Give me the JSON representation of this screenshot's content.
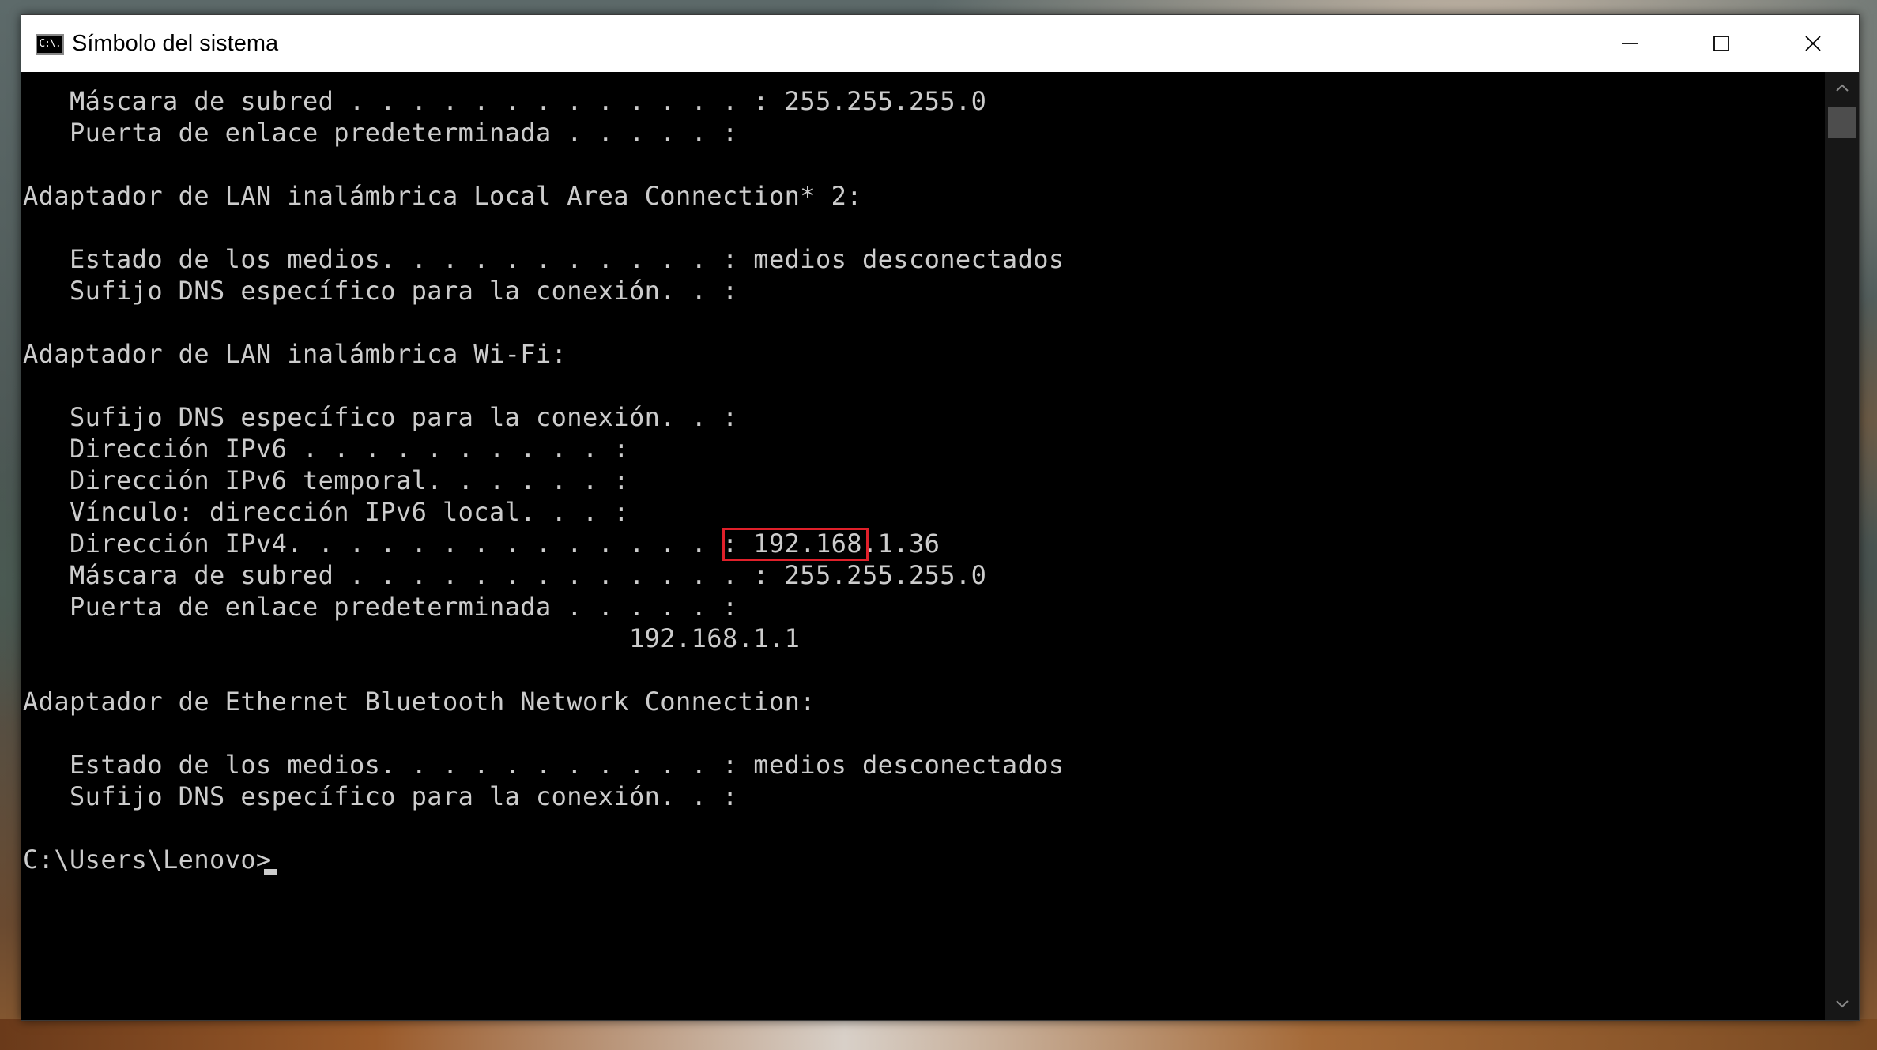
{
  "window": {
    "title": "Símbolo del sistema",
    "icon_label": "C:\\."
  },
  "caption_buttons": {
    "minimize": "minimize-icon",
    "maximize": "maximize-icon",
    "close": "close-icon"
  },
  "console": {
    "lines": [
      "   Máscara de subred . . . . . . . . . . . . . : 255.255.255.0",
      "   Puerta de enlace predeterminada . . . . . :",
      "",
      "Adaptador de LAN inalámbrica Local Area Connection* 2:",
      "",
      "   Estado de los medios. . . . . . . . . . . : medios desconectados",
      "   Sufijo DNS específico para la conexión. . :",
      "",
      "Adaptador de LAN inalámbrica Wi-Fi:",
      "",
      "   Sufijo DNS específico para la conexión. . :",
      "   Dirección IPv6 . . . . . . . . . . :",
      "   Dirección IPv6 temporal. . . . . . :",
      "   Vínculo: dirección IPv6 local. . . :",
      "   Dirección IPv4. . . . . . . . . . . . . . : 192.168.1.36",
      "   Máscara de subred . . . . . . . . . . . . . : 255.255.255.0",
      "   Puerta de enlace predeterminada . . . . . :",
      "                                       192.168.1.1",
      "",
      "Adaptador de Ethernet Bluetooth Network Connection:",
      "",
      "   Estado de los medios. . . . . . . . . . . : medios desconectados",
      "   Sufijo DNS específico para la conexión. . :",
      "",
      "C:\\Users\\Lenovo>"
    ],
    "highlighted_text": "192.168.1",
    "highlight_color": "#e0202a",
    "text_color": "#cccccc",
    "background_color": "#000000"
  }
}
